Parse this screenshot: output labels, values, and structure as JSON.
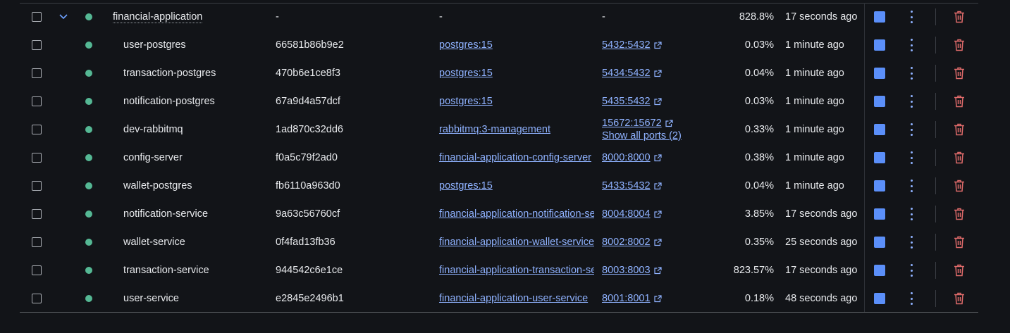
{
  "colors": {
    "background": "#121418",
    "status_running": "#55b894",
    "link": "#8fb2ff",
    "action_blue": "#5b8ff9",
    "delete_red": "#e06b6b"
  },
  "group": {
    "name": "financial-application",
    "container_id": "-",
    "image": "-",
    "ports": "-",
    "cpu": "828.8%",
    "last_started": "17 seconds ago"
  },
  "containers": [
    {
      "name": "user-postgres",
      "container_id": "66581b86b9e2",
      "image": "postgres:15",
      "ports": "5432:5432",
      "cpu": "0.03%",
      "last_started": "1 minute ago"
    },
    {
      "name": "transaction-postgres",
      "container_id": "470b6e1ce8f3",
      "image": "postgres:15",
      "ports": "5434:5432",
      "cpu": "0.04%",
      "last_started": "1 minute ago"
    },
    {
      "name": "notification-postgres",
      "container_id": "67a9d4a57dcf",
      "image": "postgres:15",
      "ports": "5435:5432",
      "cpu": "0.03%",
      "last_started": "1 minute ago"
    },
    {
      "name": "dev-rabbitmq",
      "container_id": "1ad870c32dd6",
      "image": "rabbitmq:3-management",
      "ports": "15672:15672",
      "ports_more": "Show all ports (2)",
      "cpu": "0.33%",
      "last_started": "1 minute ago"
    },
    {
      "name": "config-server",
      "container_id": "f0a5c79f2ad0",
      "image": "financial-application-config-server",
      "ports": "8000:8000",
      "cpu": "0.38%",
      "last_started": "1 minute ago"
    },
    {
      "name": "wallet-postgres",
      "container_id": "fb6110a963d0",
      "image": "postgres:15",
      "ports": "5433:5432",
      "cpu": "0.04%",
      "last_started": "1 minute ago"
    },
    {
      "name": "notification-service",
      "container_id": "9a63c56760cf",
      "image": "financial-application-notification-se",
      "ports": "8004:8004",
      "cpu": "3.85%",
      "last_started": "17 seconds ago"
    },
    {
      "name": "wallet-service",
      "container_id": "0f4fad13fb36",
      "image": "financial-application-wallet-service",
      "ports": "8002:8002",
      "cpu": "0.35%",
      "last_started": "25 seconds ago"
    },
    {
      "name": "transaction-service",
      "container_id": "944542c6e1ce",
      "image": "financial-application-transaction-se",
      "ports": "8003:8003",
      "cpu": "823.57%",
      "last_started": "17 seconds ago"
    },
    {
      "name": "user-service",
      "container_id": "e2845e2496b1",
      "image": "financial-application-user-service",
      "ports": "8001:8001",
      "cpu": "0.18%",
      "last_started": "48 seconds ago"
    }
  ],
  "icons": {
    "expand": "chevron-down-icon",
    "status": "status-dot-icon",
    "external": "external-link-icon",
    "start": "start-stop-icon",
    "more": "kebab-menu-icon",
    "delete": "trash-icon"
  }
}
